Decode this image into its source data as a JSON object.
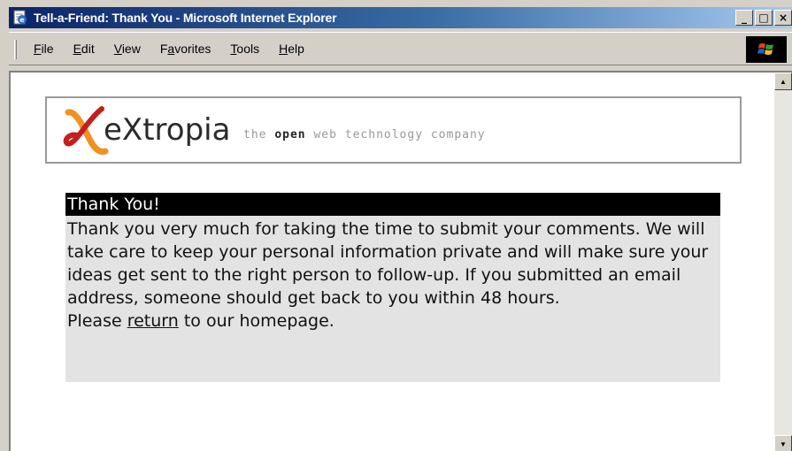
{
  "window": {
    "title": "Tell-a-Friend: Thank You - Microsoft Internet Explorer",
    "buttons": {
      "minimize": "_",
      "maximize": "□",
      "close": "×"
    }
  },
  "menu": {
    "items": [
      {
        "pre": "",
        "ul": "F",
        "post": "ile"
      },
      {
        "pre": "",
        "ul": "E",
        "post": "dit"
      },
      {
        "pre": "",
        "ul": "V",
        "post": "iew"
      },
      {
        "pre": "F",
        "ul": "a",
        "post": "vorites"
      },
      {
        "pre": "",
        "ul": "T",
        "post": "ools"
      },
      {
        "pre": "",
        "ul": "H",
        "post": "elp"
      }
    ]
  },
  "logo": {
    "brand": "eXtropia",
    "tagline_pre": "the ",
    "tagline_bold": "open",
    "tagline_post": " web technology company"
  },
  "message": {
    "heading": "Thank You!",
    "body": "Thank you very much for taking the time to submit your comments. We will take care to keep your personal information private and will make sure your ideas get sent to the right person to follow-up. If you submitted an email address, someone should get back to you within 48 hours.",
    "return_pre": "Please ",
    "return_link": "return",
    "return_post": " to our homepage."
  },
  "colors": {
    "titlebar_start": "#0a246a",
    "titlebar_end": "#a6caf0",
    "message_background": "#e3e3e3",
    "logo_orange": "#f0901e",
    "logo_red": "#c41e1e"
  },
  "icons": {
    "app": "ie-page-icon",
    "throbber": "windows-logo-icon",
    "scroll_up": "scroll-up-arrow-icon",
    "scroll_down": "scroll-down-arrow-icon"
  }
}
